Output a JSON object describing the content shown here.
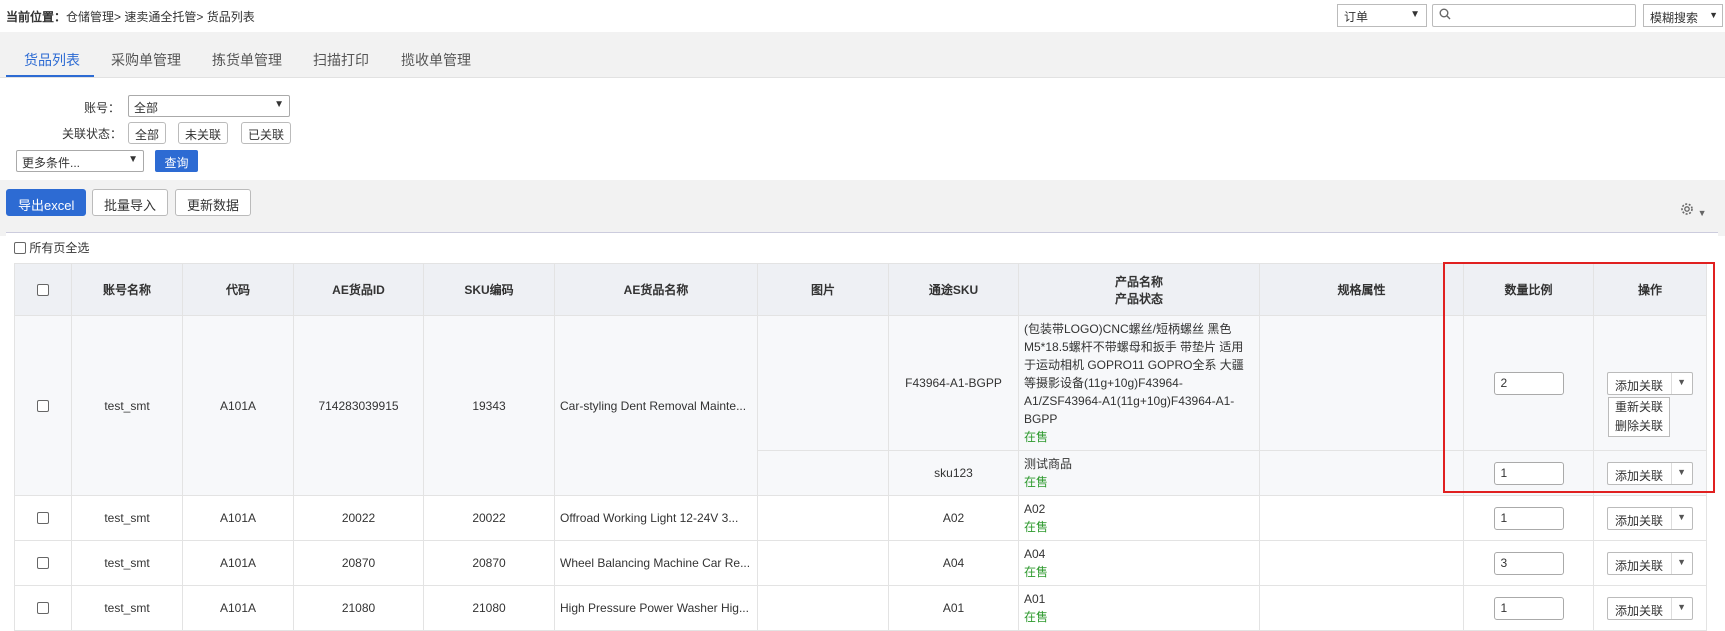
{
  "breadcrumb": {
    "prefix": "当前位置：",
    "path": "仓储管理> 速卖通全托管> 货品列表"
  },
  "top": {
    "type_select": "订单",
    "search_placeholder": "",
    "fuzzy_button": "模糊搜索"
  },
  "tabs": [
    "货品列表",
    "采购单管理",
    "拣货单管理",
    "扫描打印",
    "揽收单管理"
  ],
  "filter": {
    "account_label": "账号：",
    "account_value": "全部",
    "link_status_label": "关联状态：",
    "link_status_options": [
      "全部",
      "未关联",
      "已关联"
    ],
    "more_conditions": "更多条件...",
    "query_button": "查询"
  },
  "toolbar": {
    "export": "导出excel",
    "batch_import": "批量导入",
    "update": "更新数据"
  },
  "select_all_pages": "所有页全选",
  "table": {
    "headers": {
      "account": "账号名称",
      "code": "代码",
      "ae_id": "AE货品ID",
      "sku": "SKU编码",
      "ae_name": "AE货品名称",
      "image": "图片",
      "tongtu_sku": "通途SKU",
      "product_name": "产品名称",
      "product_status": "产品状态",
      "spec": "规格属性",
      "ratio": "数量比例",
      "action": "操作"
    },
    "rows": [
      {
        "account": "test_smt",
        "code": "A101A",
        "ae_id": "714283039915",
        "sku": "19343",
        "ae_name": "Car-styling Dent Removal Mainte...",
        "subrows": [
          {
            "tongtu_sku": "F43964-A1-BGPP",
            "product_name": "(包装带LOGO)CNC螺丝/短柄螺丝 黑色 M5*18.5螺杆不带螺母和扳手 带垫片 适用于运动相机 GOPRO11 GOPRO全系 大疆等摄影设备(11g+10g)F43964-A1/ZSF43964-A1(11g+10g)F43964-A1-BGPP",
            "status": "在售",
            "ratio": "2",
            "action": "添加关联"
          },
          {
            "tongtu_sku": "sku123",
            "product_name": "测试商品",
            "status": "在售",
            "ratio": "1",
            "action": "添加关联"
          }
        ]
      },
      {
        "account": "test_smt",
        "code": "A101A",
        "ae_id": "20022",
        "sku": "20022",
        "ae_name": "Offroad Working Light 12-24V 3...",
        "tongtu_sku": "A02",
        "product_name": "A02",
        "status": "在售",
        "ratio": "1",
        "action": "添加关联"
      },
      {
        "account": "test_smt",
        "code": "A101A",
        "ae_id": "20870",
        "sku": "20870",
        "ae_name": "Wheel Balancing Machine Car Re...",
        "tongtu_sku": "A04",
        "product_name": "A04",
        "status": "在售",
        "ratio": "3",
        "action": "添加关联"
      },
      {
        "account": "test_smt",
        "code": "A101A",
        "ae_id": "21080",
        "sku": "21080",
        "ae_name": "High Pressure Power Washer Hig...",
        "tongtu_sku": "A01",
        "product_name": "A01",
        "status": "在售",
        "ratio": "1",
        "action": "添加关联"
      }
    ],
    "action_menu": [
      "重新关联",
      "删除关联"
    ]
  },
  "icons": {
    "search": "search-icon",
    "settings": "gear-icon",
    "dropdown": "chevron-down-icon"
  },
  "colors": {
    "primary": "#2d6bd3",
    "status_green": "#2e9a2e",
    "highlight": "#e02020"
  }
}
